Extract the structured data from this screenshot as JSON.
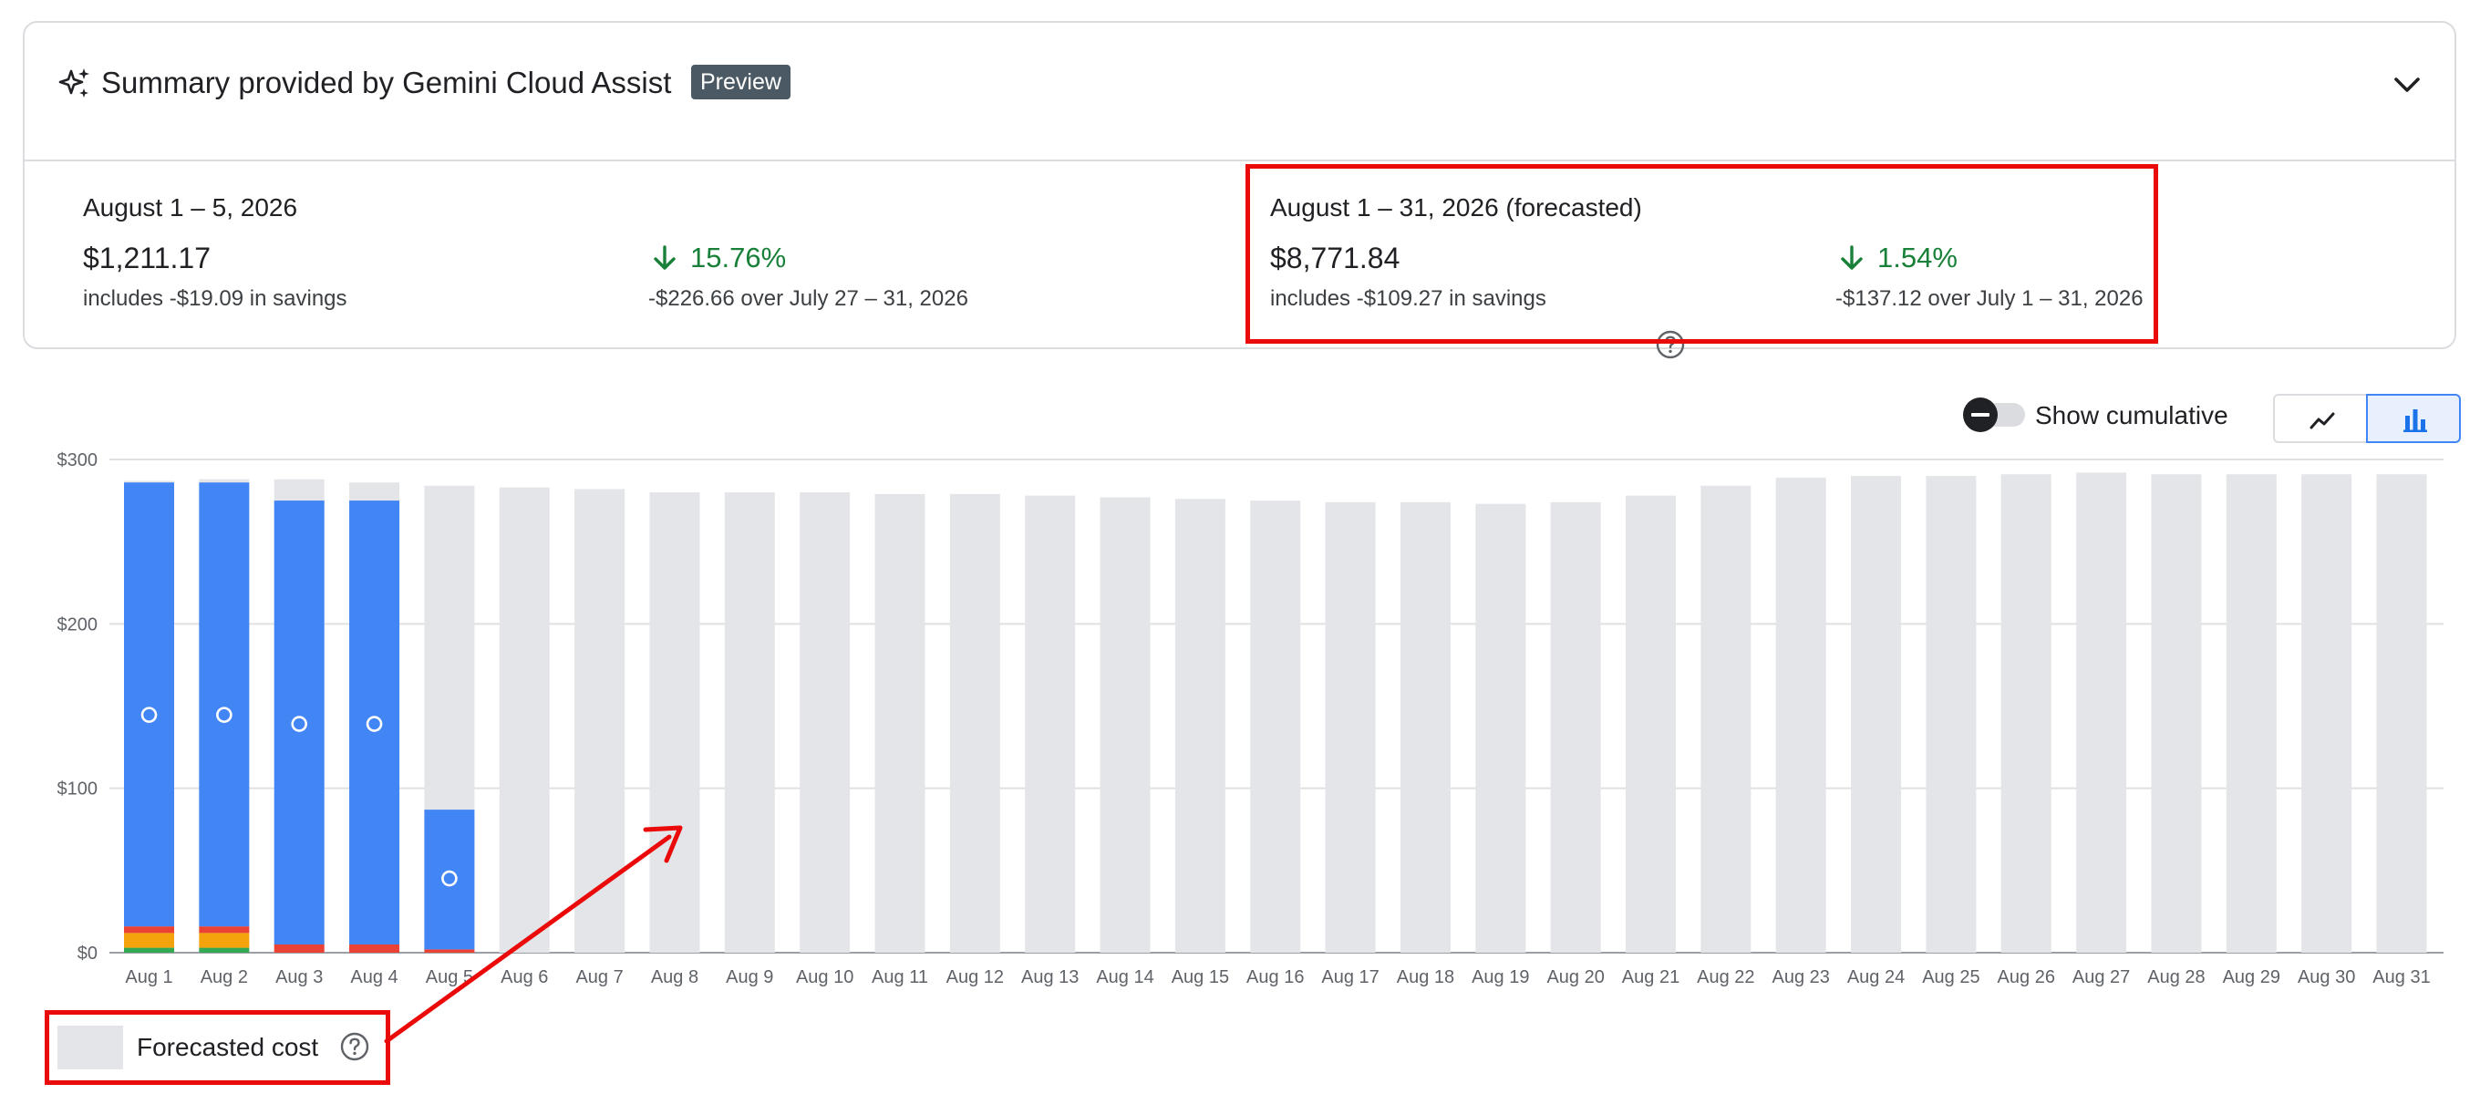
{
  "summary": {
    "title": "Summary provided by Gemini Cloud Assist",
    "badge": "Preview",
    "left": {
      "label": "August 1 – 5, 2026",
      "amount": "$1,211.17",
      "savings": "includes -$19.09 in savings",
      "change_pct": "15.76%",
      "change_detail": "-$226.66 over July 27 – 31, 2026",
      "trend": "down"
    },
    "right": {
      "label": "August 1 – 31, 2026 (forecasted)",
      "amount": "$8,771.84",
      "savings": "includes -$109.27 in savings",
      "change_pct": "1.54%",
      "change_detail": "-$137.12 over July 1 – 31, 2026",
      "trend": "down"
    }
  },
  "toolbar": {
    "cumulative_label": "Show cumulative",
    "view_options": [
      "line",
      "bar"
    ],
    "selected_view": "bar"
  },
  "legend": {
    "forecasted_label": "Forecasted cost"
  },
  "colors": {
    "actual": "#4285f4",
    "forecast": "#e3e5e8",
    "segment_orange": "#f4a30c",
    "segment_red": "#ea4335",
    "segment_green": "#34a853",
    "positive_change": "#188038",
    "highlight": "#ea0a0a"
  },
  "chart_data": {
    "type": "bar",
    "categories": [
      "Aug 1",
      "Aug 2",
      "Aug 3",
      "Aug 4",
      "Aug 5",
      "Aug 6",
      "Aug 7",
      "Aug 8",
      "Aug 9",
      "Aug 10",
      "Aug 11",
      "Aug 12",
      "Aug 13",
      "Aug 14",
      "Aug 15",
      "Aug 16",
      "Aug 17",
      "Aug 18",
      "Aug 19",
      "Aug 20",
      "Aug 21",
      "Aug 22",
      "Aug 23",
      "Aug 24",
      "Aug 25",
      "Aug 26",
      "Aug 27",
      "Aug 28",
      "Aug 29",
      "Aug 30",
      "Aug 31"
    ],
    "y_ticks": [
      "$0",
      "$100",
      "$200",
      "$300"
    ],
    "ylim": [
      0,
      300
    ],
    "grid": true,
    "series": [
      {
        "name": "Forecasted cost",
        "values": [
          287,
          288,
          288,
          286,
          284,
          283,
          282,
          280,
          280,
          280,
          279,
          279,
          278,
          277,
          276,
          275,
          274,
          274,
          273,
          274,
          278,
          284,
          289,
          290,
          290,
          291,
          292,
          291,
          291,
          291,
          291
        ]
      },
      {
        "values": [
          270,
          270,
          270,
          270,
          85,
          null,
          null,
          null,
          null,
          null,
          null,
          null,
          null,
          null,
          null,
          null,
          null,
          null,
          null,
          null,
          null,
          null,
          null,
          null,
          null,
          null,
          null,
          null,
          null,
          null,
          null
        ]
      },
      {
        "values": [
          4,
          4,
          5,
          5,
          2,
          null,
          null,
          null,
          null,
          null,
          null,
          null,
          null,
          null,
          null,
          null,
          null,
          null,
          null,
          null,
          null,
          null,
          null,
          null,
          null,
          null,
          null,
          null,
          null,
          null,
          null
        ]
      },
      {
        "values": [
          9,
          9,
          0,
          0,
          0,
          null,
          null,
          null,
          null,
          null,
          null,
          null,
          null,
          null,
          null,
          null,
          null,
          null,
          null,
          null,
          null,
          null,
          null,
          null,
          null,
          null,
          null,
          null,
          null,
          null,
          null
        ]
      },
      {
        "values": [
          3,
          3,
          0,
          0,
          0,
          null,
          null,
          null,
          null,
          null,
          null,
          null,
          null,
          null,
          null,
          null,
          null,
          null,
          null,
          null,
          null,
          null,
          null,
          null,
          null,
          null,
          null,
          null,
          null,
          null,
          null
        ]
      }
    ]
  }
}
